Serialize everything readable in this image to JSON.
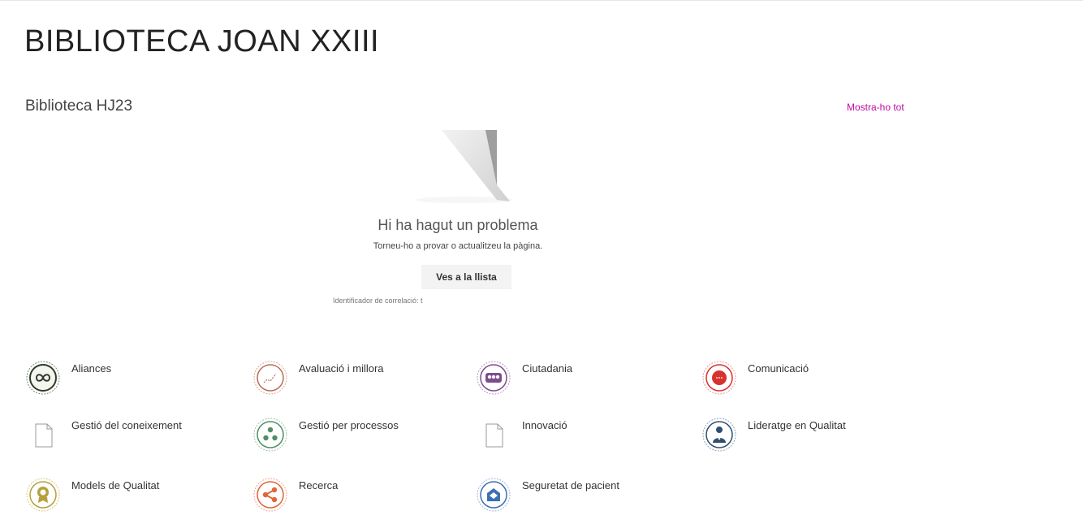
{
  "page": {
    "title": "BIBLIOTECA JOAN XXIII"
  },
  "webpart": {
    "title": "Biblioteca HJ23",
    "show_all": "Mostra-ho tot",
    "error": {
      "heading": "Hi ha hagut un problema",
      "message": "Torneu-ho a provar o actualitzeu la pàgina.",
      "button": "Ves a la llista",
      "correlation": "Identificador de correlació: t"
    }
  },
  "links": [
    {
      "label": "Aliances",
      "icon": "infinity-icon",
      "color": "#2f3b2a"
    },
    {
      "label": "Avaluació i millora",
      "icon": "chart-trend-icon",
      "color": "#b6705a"
    },
    {
      "label": "Ciutadania",
      "icon": "people-icon",
      "color": "#7d4c8c"
    },
    {
      "label": "Comunicació",
      "icon": "chat-bubble-icon",
      "color": "#d8322f"
    },
    {
      "label": "Gestió del coneixement",
      "icon": "document-icon",
      "color": "#999999"
    },
    {
      "label": "Gestió per processos",
      "icon": "process-cycle-icon",
      "color": "#4e8f63"
    },
    {
      "label": "Innovació",
      "icon": "document-icon",
      "color": "#999999"
    },
    {
      "label": "Lideratge en Qualitat",
      "icon": "leader-person-icon",
      "color": "#2f4f6f"
    },
    {
      "label": "Models de Qualitat",
      "icon": "award-medal-icon",
      "color": "#b5a03a"
    },
    {
      "label": "Recerca",
      "icon": "share-network-icon",
      "color": "#e0663a"
    },
    {
      "label": "Seguretat de pacient",
      "icon": "safety-envelope-icon",
      "color": "#3d6fb5"
    }
  ]
}
